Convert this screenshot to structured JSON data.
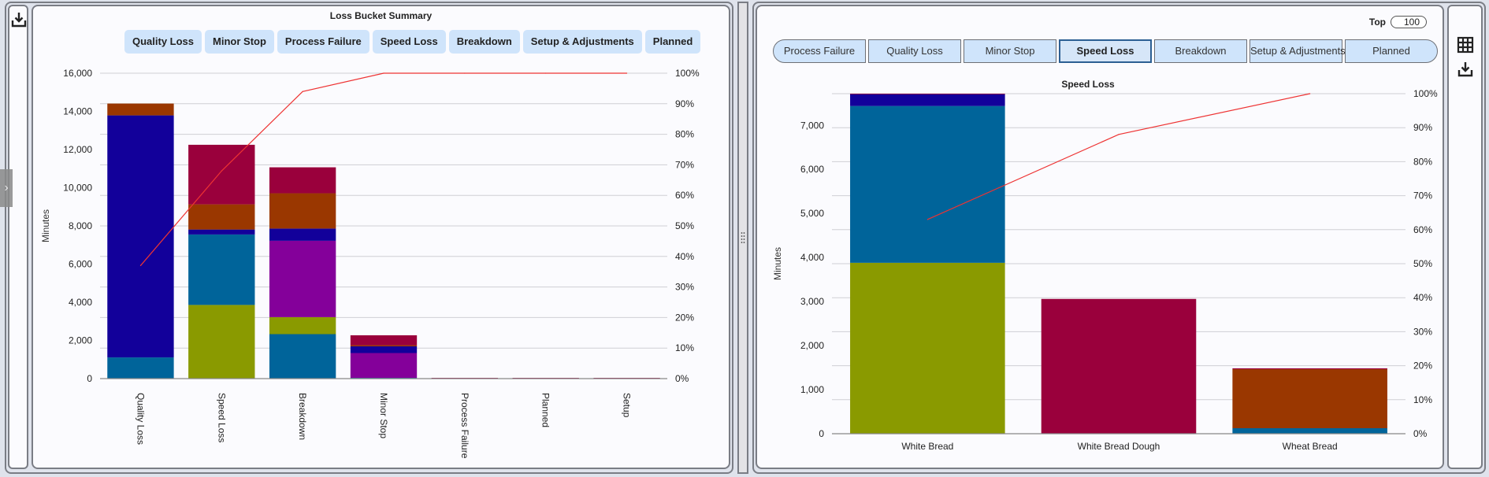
{
  "left_panel": {
    "download_icon": "download-icon",
    "title": "Loss Bucket Summary",
    "filter_pills": [
      "Quality Loss",
      "Minor Stop",
      "Process Failure",
      "Speed Loss",
      "Breakdown",
      "Setup & Adjustments",
      "Planned"
    ]
  },
  "right_panel": {
    "top_label": "Top",
    "top_value": "100",
    "tabs": [
      {
        "label": "Process Failure",
        "active": false
      },
      {
        "label": "Quality Loss",
        "active": false
      },
      {
        "label": "Minor Stop",
        "active": false
      },
      {
        "label": "Speed Loss",
        "active": true
      },
      {
        "label": "Breakdown",
        "active": false
      },
      {
        "label": "Setup & Adjustments",
        "active": false
      },
      {
        "label": "Planned",
        "active": false
      }
    ],
    "table_icon": "table-grid-icon",
    "download_icon": "download-icon"
  },
  "segment_colors": {
    "teal": "#00649a",
    "olive": "#8a9a00",
    "purple": "#84009a",
    "indigo": "#12009a",
    "brown": "#9a3700",
    "crimson": "#9a003c"
  },
  "pareto_line_color": "#ee3333",
  "chart_data": [
    {
      "type": "bar",
      "stacked": true,
      "title": "Loss Bucket Summary",
      "xlabel": "",
      "ylabel": "Minutes",
      "y2label": "",
      "ylim": [
        0,
        16000
      ],
      "yticks": [
        "0",
        "2,000",
        "4,000",
        "6,000",
        "8,000",
        "10,000",
        "12,000",
        "14,000",
        "16,000"
      ],
      "y2lim": [
        0,
        100
      ],
      "y2ticks": [
        "0%",
        "10%",
        "20%",
        "30%",
        "40%",
        "50%",
        "60%",
        "70%",
        "80%",
        "90%",
        "100%"
      ],
      "grid": true,
      "categories": [
        "Quality Loss",
        "Speed Loss",
        "Breakdown",
        "Minor Stop",
        "Process Failure",
        "Planned",
        "Setup"
      ],
      "series": [
        {
          "name": "teal",
          "color": "teal",
          "values": [
            1110,
            0,
            2330,
            40,
            0,
            0,
            0
          ]
        },
        {
          "name": "olive",
          "color": "olive",
          "values": [
            0,
            3860,
            890,
            0,
            0,
            0,
            0
          ]
        },
        {
          "name": "teal-2",
          "color": "teal",
          "values": [
            0,
            3690,
            0,
            0,
            0,
            0,
            0
          ]
        },
        {
          "name": "purple",
          "color": "purple",
          "values": [
            0,
            0,
            4000,
            1300,
            0,
            0,
            0
          ]
        },
        {
          "name": "indigo",
          "color": "indigo",
          "values": [
            12680,
            260,
            640,
            350,
            0,
            0,
            0
          ]
        },
        {
          "name": "brown",
          "color": "brown",
          "values": [
            620,
            1320,
            1850,
            60,
            0,
            0,
            0
          ]
        },
        {
          "name": "crimson",
          "color": "crimson",
          "values": [
            0,
            3120,
            1360,
            520,
            40,
            40,
            40
          ]
        }
      ],
      "cumulative_percent": {
        "name": "Cumulative %",
        "values": [
          37,
          68,
          94,
          100,
          100,
          100,
          100
        ]
      }
    },
    {
      "type": "bar",
      "stacked": true,
      "title": "Speed Loss",
      "xlabel": "",
      "ylabel": "Minutes",
      "ylim": [
        0,
        7720
      ],
      "yticks": [
        "0",
        "1,000",
        "2,000",
        "3,000",
        "4,000",
        "5,000",
        "6,000",
        "7,000"
      ],
      "y2lim": [
        0,
        100
      ],
      "y2ticks": [
        "0%",
        "10%",
        "20%",
        "30%",
        "40%",
        "50%",
        "60%",
        "70%",
        "80%",
        "90%",
        "100%"
      ],
      "grid": true,
      "categories": [
        "White Bread",
        "White Bread Dough",
        "Wheat Bread"
      ],
      "series": [
        {
          "name": "olive",
          "color": "olive",
          "values": [
            3880,
            0,
            0
          ]
        },
        {
          "name": "teal",
          "color": "teal",
          "values": [
            3560,
            0,
            125
          ]
        },
        {
          "name": "indigo",
          "color": "indigo",
          "values": [
            270,
            0,
            0
          ]
        },
        {
          "name": "brown",
          "color": "brown",
          "values": [
            0,
            0,
            1340
          ]
        },
        {
          "name": "crimson",
          "color": "crimson",
          "values": [
            10,
            3060,
            20
          ]
        }
      ],
      "cumulative_percent": {
        "name": "Cumulative %",
        "values": [
          63,
          88,
          100
        ]
      }
    }
  ]
}
